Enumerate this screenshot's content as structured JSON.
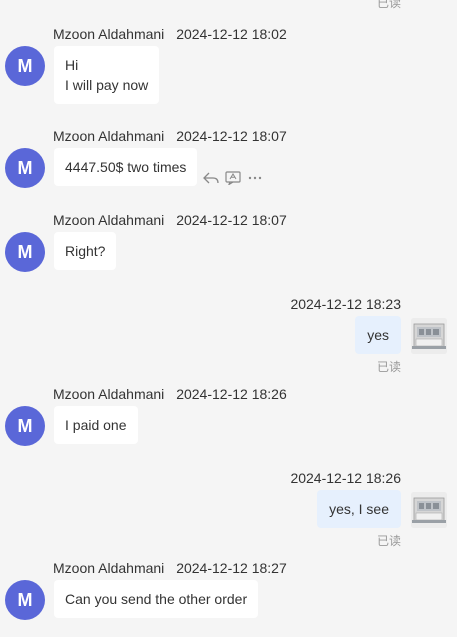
{
  "read_label": "已读",
  "avatar_letter": "M",
  "messages": [
    {
      "direction": "in",
      "sender": "Mzoon Aldahmani",
      "time": "2024-12-12 18:02",
      "lines": [
        "Hi",
        "I will pay now"
      ]
    },
    {
      "direction": "in",
      "sender": "Mzoon Aldahmani",
      "time": "2024-12-12 18:07",
      "text": "4447.50$ two times"
    },
    {
      "direction": "in",
      "sender": "Mzoon Aldahmani",
      "time": "2024-12-12 18:07",
      "text": "Right?"
    },
    {
      "direction": "out",
      "time": "2024-12-12 18:23",
      "text": "yes",
      "status": "已读"
    },
    {
      "direction": "in",
      "sender": "Mzoon Aldahmani",
      "time": "2024-12-12 18:26",
      "text": "I paid one"
    },
    {
      "direction": "out",
      "time": "2024-12-12 18:26",
      "text": "yes, I see",
      "status": "已读"
    },
    {
      "direction": "in",
      "sender": "Mzoon Aldahmani",
      "time": "2024-12-12 18:27",
      "text": "Can you send the other order"
    }
  ],
  "colors": {
    "avatar_bg": "#5a67d8",
    "bubble_in": "#ffffff",
    "bubble_out": "#e6f0fd",
    "background": "#f5f5f5",
    "read_text": "#999999"
  },
  "action_icons": [
    "reply-icon",
    "translate-icon",
    "more-icon"
  ]
}
